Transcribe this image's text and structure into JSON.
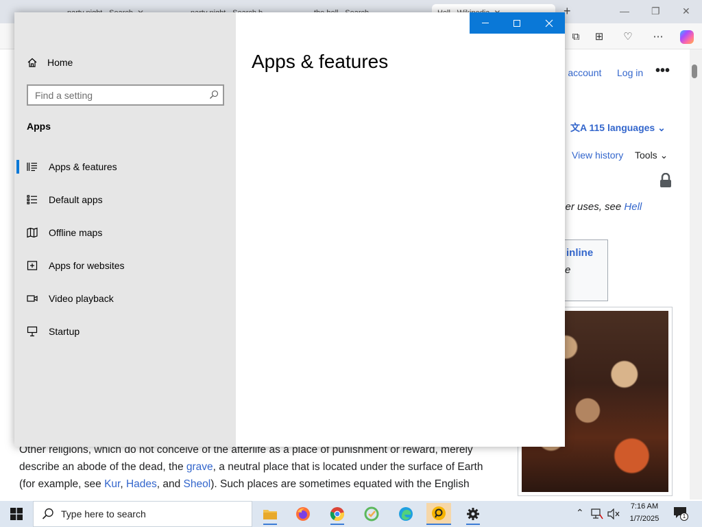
{
  "browser": {
    "tabs": [
      {
        "label": "party night - Search",
        "active": false
      },
      {
        "label": "party night - Search b",
        "active": false
      },
      {
        "label": "the hell - Search",
        "active": false
      },
      {
        "label": "Hell - Wikipedia",
        "active": true
      }
    ],
    "wiki": {
      "create_account": "ate account",
      "login": "Log in",
      "languages": "115 languages",
      "view_history": "View history",
      "tools": "Tools",
      "other_uses": "ther uses, see",
      "other_uses_link": "Hell",
      "hatnote_inline": "inline",
      "hatnote_e": "e",
      "para_line1": "Other religions, which do not conceive of the afterlife as a place of punishment or reward, merely",
      "para_line2_a": "describe an abode of the dead, the ",
      "para_line2_link": "grave",
      "para_line2_b": ", a neutral place that is located under the surface of Earth",
      "para_line3_a": "(for example, see ",
      "para_line3_link1": "Kur",
      "para_line3_sep1": ", ",
      "para_line3_link2": "Hades",
      "para_line3_sep2": ", and ",
      "para_line3_link3": "Sheol",
      "para_line3_b": "). Such places are sometimes equated with the English"
    }
  },
  "settings": {
    "home_label": "Home",
    "search_placeholder": "Find a setting",
    "section_heading": "Apps",
    "nav_items": [
      {
        "label": "Apps & features",
        "icon": "apps-features-icon",
        "selected": true
      },
      {
        "label": "Default apps",
        "icon": "default-apps-icon",
        "selected": false
      },
      {
        "label": "Offline maps",
        "icon": "offline-maps-icon",
        "selected": false
      },
      {
        "label": "Apps for websites",
        "icon": "apps-websites-icon",
        "selected": false
      },
      {
        "label": "Video playback",
        "icon": "video-playback-icon",
        "selected": false
      },
      {
        "label": "Startup",
        "icon": "startup-icon",
        "selected": false
      }
    ],
    "page_title": "Apps & features",
    "accent_color": "#0a78d7"
  },
  "taskbar": {
    "search_placeholder": "Type here to search",
    "apps": [
      "file-explorer-icon",
      "firefox-icon",
      "chrome-icon",
      "app-icon",
      "edge-icon",
      "app-active-icon",
      "settings-icon"
    ],
    "time": "7:16 AM",
    "date": "1/7/2025",
    "notification_count": "1"
  }
}
